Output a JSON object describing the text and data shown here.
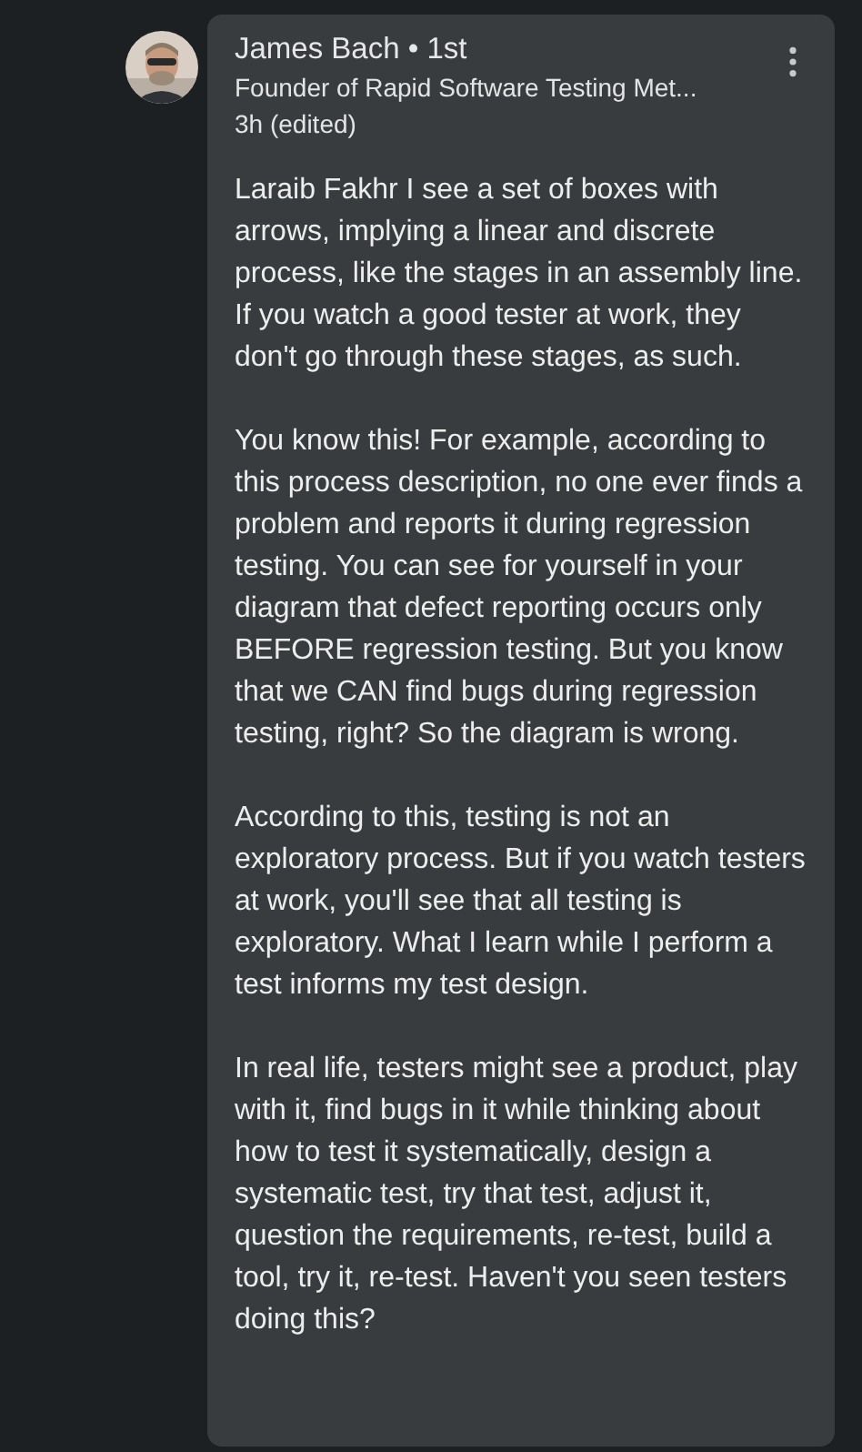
{
  "comment": {
    "author": "James Bach • 1st",
    "headline": "Founder of Rapid Software Testing Met...",
    "time": "3h (edited)",
    "paragraphs": [
      "Laraib Fakhr I see a set of boxes with arrows, implying a linear and discrete process, like the stages in an assembly line. If you watch a good tester at work, they don't go through these stages, as such.",
      "You know this! For example, according to this process description, no one ever finds a problem and reports it during regression testing. You can see for yourself in your diagram that defect reporting occurs only BEFORE regression testing. But you know that we CAN find bugs during regression testing, right? So the diagram is wrong.",
      "According to this, testing is not an exploratory process. But if you watch testers at work, you'll see that all testing is exploratory. What I learn while I perform a test informs my test design.",
      "In real life, testers might see a product, play with it, find bugs in it while thinking about how to test it systematically, design a systematic test, try that test, adjust it, question the requirements, re-test, build a tool, try it, re-test. Haven't you seen testers doing this?"
    ]
  }
}
